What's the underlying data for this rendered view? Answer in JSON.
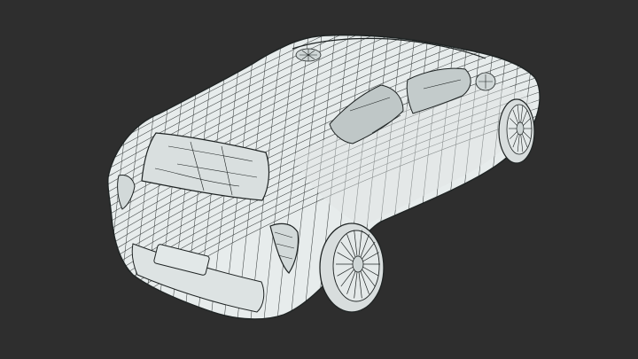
{
  "scene": {
    "background_color": "#2e2e2e",
    "subject": "car-wireframe-mesh",
    "mesh_fill_color": "#e7ecec",
    "mesh_shade_color": "#c9d0d0",
    "wire_color": "#1f2424",
    "tire_color": "#d8dddd",
    "interior_shadow_color": "#a9b2b2"
  }
}
